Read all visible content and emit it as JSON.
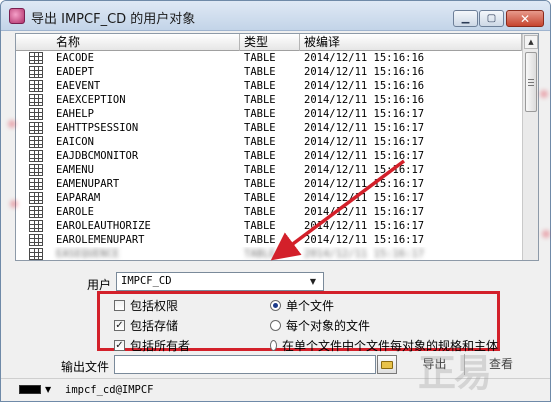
{
  "window": {
    "title": "导出 IMPCF_CD 的用户对象"
  },
  "grid": {
    "columns": [
      "名称",
      "类型",
      "被编译"
    ],
    "rows": [
      {
        "name": "EACODE",
        "type": "TABLE",
        "date": "2014/12/11 15:16:16"
      },
      {
        "name": "EADEPT",
        "type": "TABLE",
        "date": "2014/12/11 15:16:16"
      },
      {
        "name": "EAEVENT",
        "type": "TABLE",
        "date": "2014/12/11 15:16:16"
      },
      {
        "name": "EAEXCEPTION",
        "type": "TABLE",
        "date": "2014/12/11 15:16:16"
      },
      {
        "name": "EAHELP",
        "type": "TABLE",
        "date": "2014/12/11 15:16:17"
      },
      {
        "name": "EAHTTPSESSION",
        "type": "TABLE",
        "date": "2014/12/11 15:16:17"
      },
      {
        "name": "EAICON",
        "type": "TABLE",
        "date": "2014/12/11 15:16:17"
      },
      {
        "name": "EAJDBCMONITOR",
        "type": "TABLE",
        "date": "2014/12/11 15:16:17"
      },
      {
        "name": "EAMENU",
        "type": "TABLE",
        "date": "2014/12/11 15:16:17"
      },
      {
        "name": "EAMENUPART",
        "type": "TABLE",
        "date": "2014/12/11 15:16:17"
      },
      {
        "name": "EAPARAM",
        "type": "TABLE",
        "date": "2014/12/11 15:16:17"
      },
      {
        "name": "EAROLE",
        "type": "TABLE",
        "date": "2014/12/11 15:16:17"
      },
      {
        "name": "EAROLEAUTHORIZE",
        "type": "TABLE",
        "date": "2014/12/11 15:16:17"
      },
      {
        "name": "EAROLEMENUPART",
        "type": "TABLE",
        "date": "2014/12/11 15:16:17"
      },
      {
        "name": "EASEQUENCE",
        "type": "TABLE",
        "date": "2014/12/11 15:16:17"
      }
    ]
  },
  "user": {
    "label": "用户",
    "value": "IMPCF_CD"
  },
  "options": {
    "checkboxes": [
      {
        "label": "包括权限",
        "checked": false
      },
      {
        "label": "包括存储",
        "checked": true
      },
      {
        "label": "包括所有者",
        "checked": true
      }
    ],
    "radios": [
      {
        "label": "单个文件",
        "selected": true
      },
      {
        "label": "每个对象的文件",
        "selected": false
      },
      {
        "label": "在单个文件中个文件每对象的规格和主体",
        "selected": false
      }
    ]
  },
  "output": {
    "label": "输出文件",
    "value": "",
    "export_label": "导出",
    "view_label": "查看"
  },
  "status": {
    "text": "impcf_cd@IMPCF"
  },
  "colors": {
    "highlight_box": "#d3202a",
    "arrow": "#d3202a"
  }
}
